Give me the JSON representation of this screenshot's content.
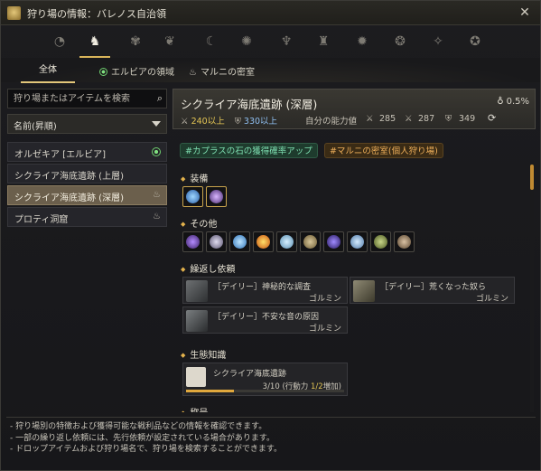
{
  "window": {
    "title": "狩り場の情報：バレノス自治領",
    "close": "✕"
  },
  "categories": [
    {
      "name": "region-1",
      "glyph": "◔"
    },
    {
      "name": "region-horse",
      "glyph": "♞"
    },
    {
      "name": "region-3",
      "glyph": "✾"
    },
    {
      "name": "region-4",
      "glyph": "❦"
    },
    {
      "name": "region-5",
      "glyph": "☾"
    },
    {
      "name": "region-6",
      "glyph": "✺"
    },
    {
      "name": "region-7",
      "glyph": "♆"
    },
    {
      "name": "region-8",
      "glyph": "♜"
    },
    {
      "name": "region-9",
      "glyph": "✹"
    },
    {
      "name": "region-10",
      "glyph": "❂"
    },
    {
      "name": "region-11",
      "glyph": "✧"
    },
    {
      "name": "region-12",
      "glyph": "✪"
    }
  ],
  "filters": {
    "all": "全体",
    "elvia": "エルビアの領域",
    "marni": "マルニの密室"
  },
  "search": {
    "placeholder": "狩り場またはアイテムを検索"
  },
  "sort": {
    "label": "名前(昇順)"
  },
  "zones": [
    {
      "label": "オルゼキア [エルビア]"
    },
    {
      "label": "シクライア海底遺跡 (上層)"
    },
    {
      "label": "シクライア海底遺跡 (深層)"
    },
    {
      "label": "プロティ洞窟"
    }
  ],
  "detail": {
    "name": "シクライア海底遺跡 (深層)",
    "drop_rate": "0.5%",
    "ap": "240以上",
    "dp": "330以上",
    "my_stats_label": "自分の能力値",
    "my_ap": "285",
    "my_awk_ap": "287",
    "my_dp": "349",
    "tags": [
      "#カプラスの石の獲得確率アップ",
      "#マルニの密室(個人狩り場)"
    ],
    "sections": {
      "equipment": "装備",
      "other": "その他",
      "quests": "繰返し依頼",
      "knowledge": "生態知識",
      "more": "称号"
    },
    "quests": [
      {
        "title": "［デイリー］神秘的な調査",
        "npc": "ゴルミン"
      },
      {
        "title": "［デイリー］荒くなった奴ら",
        "npc": "ゴルミン"
      },
      {
        "title": "［デイリー］不安な音の原因",
        "npc": "ゴルミン"
      }
    ],
    "knowledge": {
      "title": "シクライア海底遺跡",
      "progress": "3/10",
      "energy_prefix": "(行動力 ",
      "energy_value": "1/2",
      "energy_suffix": "増加)",
      "fill": 0.3
    }
  },
  "footer": [
    "- 狩り場別の特徴および獲得可能な戦利品などの情報を確認できます。",
    "- 一部の繰り返し依頼には、先行依頼が設定されている場合があります。",
    "- ドロップアイテムおよび狩り場名で、狩り場を検索することができます。"
  ]
}
